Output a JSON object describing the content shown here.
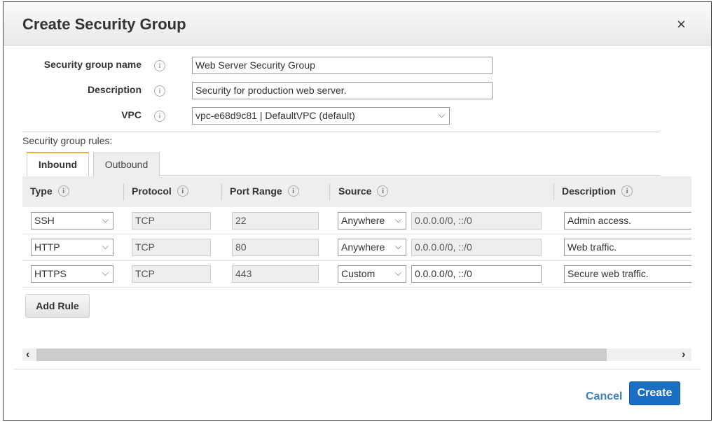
{
  "dialog": {
    "title": "Create Security Group",
    "close": "×"
  },
  "form": {
    "name_label": "Security group name",
    "name_value": "Web Server Security Group",
    "desc_label": "Description",
    "desc_value": "Security for production web server.",
    "vpc_label": "VPC",
    "vpc_value": "vpc-e68d9c81 | DefaultVPC (default)"
  },
  "rules_label": "Security group rules:",
  "tabs": [
    {
      "label": "Inbound",
      "active": true
    },
    {
      "label": "Outbound",
      "active": false
    }
  ],
  "columns": [
    "Type",
    "Protocol",
    "Port Range",
    "Source",
    "Description"
  ],
  "rows": [
    {
      "type": "SSH",
      "protocol": "TCP",
      "port": "22",
      "source": "Anywhere",
      "cidr": "0.0.0.0/0, ::/0",
      "description": "Admin access."
    },
    {
      "type": "HTTP",
      "protocol": "TCP",
      "port": "80",
      "source": "Anywhere",
      "cidr": "0.0.0.0/0, ::/0",
      "description": "Web traffic."
    },
    {
      "type": "HTTPS",
      "protocol": "TCP",
      "port": "443",
      "source": "Custom",
      "cidr": "0.0.0.0/0, ::/0",
      "description": "Secure web traffic."
    }
  ],
  "add_rule": "Add Rule",
  "scroll": {
    "left": "‹",
    "right": "›"
  },
  "footer": {
    "cancel": "Cancel",
    "create": "Create"
  },
  "info_glyph": "i",
  "colors": {
    "primary": "#1a6fc4",
    "link": "#3a7fc1"
  }
}
